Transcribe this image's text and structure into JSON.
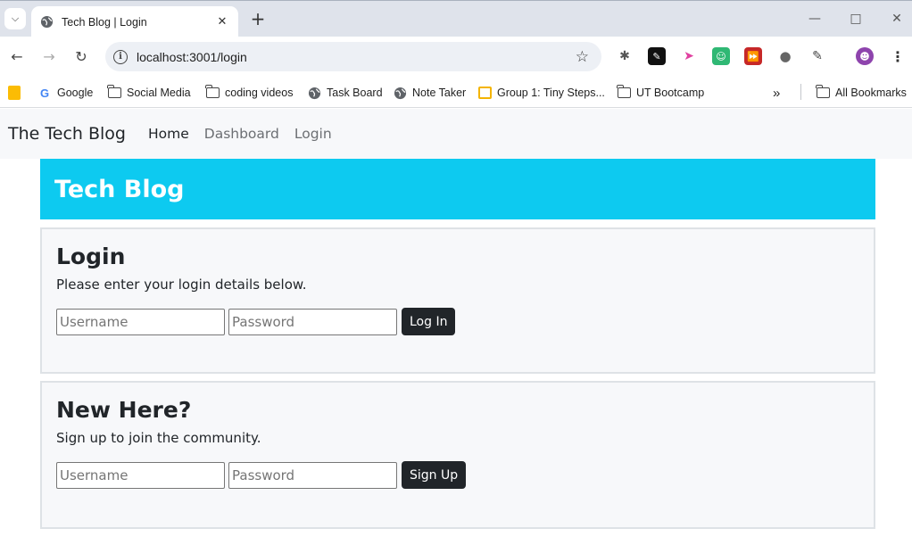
{
  "browser": {
    "tab_title": "Tech Blog | Login",
    "url": "localhost:3001/login",
    "bookmarks": [
      {
        "label": "Google",
        "icon": "google-icon"
      },
      {
        "label": "Social Media",
        "icon": "folder-icon"
      },
      {
        "label": "coding videos",
        "icon": "folder-icon"
      },
      {
        "label": "Task Board",
        "icon": "globe-icon"
      },
      {
        "label": "Note Taker",
        "icon": "globe-icon"
      },
      {
        "label": "Group 1: Tiny Steps...",
        "icon": "bookmark-icon"
      },
      {
        "label": "UT Bootcamp",
        "icon": "folder-icon"
      }
    ],
    "all_bookmarks": "All Bookmarks"
  },
  "site": {
    "brand": "The Tech Blog",
    "nav": [
      {
        "label": "Home"
      },
      {
        "label": "Dashboard"
      },
      {
        "label": "Login"
      }
    ],
    "hero_title": "Tech Blog",
    "accent_color": "#0dcaf0"
  },
  "login": {
    "title": "Login",
    "text": "Please enter your login details below.",
    "username_placeholder": "Username",
    "password_placeholder": "Password",
    "button": "Log In"
  },
  "signup": {
    "title": "New Here?",
    "text": "Sign up to join the community.",
    "username_placeholder": "Username",
    "password_placeholder": "Password",
    "button": "Sign Up"
  }
}
